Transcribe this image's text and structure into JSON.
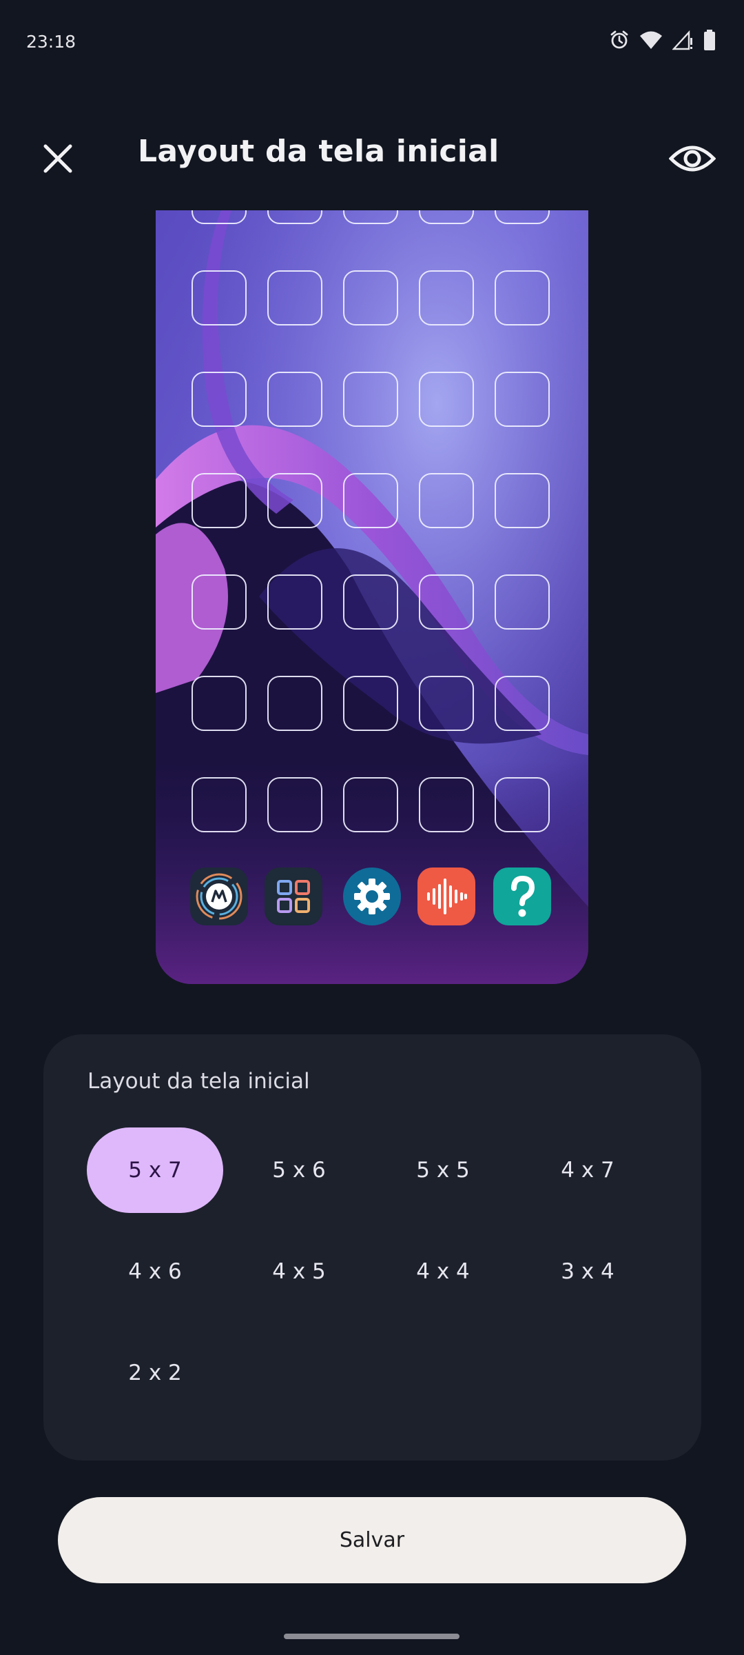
{
  "status_bar": {
    "time": "23:18",
    "icons": [
      "alarm-icon",
      "wifi-icon",
      "signal-icon",
      "battery-icon"
    ]
  },
  "app_bar": {
    "title": "Layout da tela inicial",
    "close_icon": "close-icon",
    "preview_icon": "eye-icon"
  },
  "preview": {
    "grid": {
      "columns": 5,
      "rows": 7
    },
    "dock_icons": [
      "moto-app-icon",
      "app-grid-icon",
      "settings-icon",
      "voice-recorder-icon",
      "help-icon"
    ]
  },
  "layout_card": {
    "title": "Layout da tela inicial",
    "options": [
      {
        "label": "5 x 7",
        "selected": true
      },
      {
        "label": "5 x 6",
        "selected": false
      },
      {
        "label": "5 x 5",
        "selected": false
      },
      {
        "label": "4 x 7",
        "selected": false
      },
      {
        "label": "4 x 6",
        "selected": false
      },
      {
        "label": "4 x 5",
        "selected": false
      },
      {
        "label": "4 x 4",
        "selected": false
      },
      {
        "label": "3 x 4",
        "selected": false
      },
      {
        "label": "2 x 2",
        "selected": false
      }
    ]
  },
  "save_button": {
    "label": "Salvar"
  },
  "colors": {
    "background": "#121620",
    "card": "#1d212c",
    "selected_chip": "#dfb8fb",
    "save_button": "#f1eeeb"
  }
}
